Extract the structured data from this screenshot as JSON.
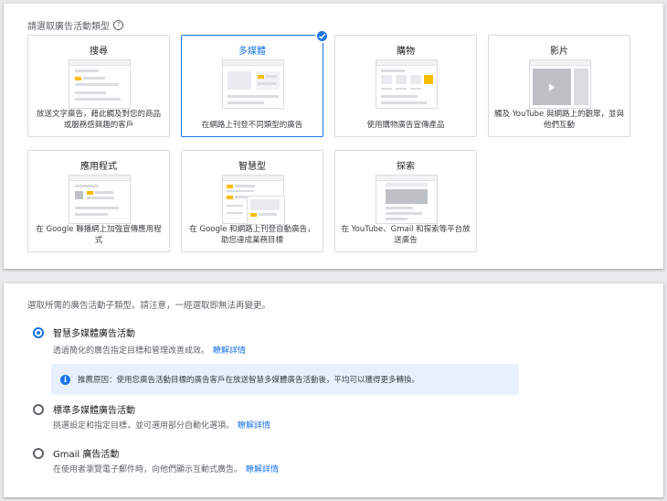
{
  "campaign_types": {
    "title": "請選取廣告活動類型",
    "help_icon": "question-circle-icon",
    "tiles": [
      {
        "label": "搜尋",
        "desc": "放送文字廣告，藉此觸及對您的商品或服務感興趣的客戶"
      },
      {
        "label": "多媒體",
        "desc": "在網路上刊登不同類型的廣告",
        "selected": true
      },
      {
        "label": "購物",
        "desc": "使用購物廣告宣傳產品"
      },
      {
        "label": "影片",
        "desc": "觸及 YouTube 與網路上的觀眾，並與他們互動"
      },
      {
        "label": "應用程式",
        "desc": "在 Google 聯播網上加強宣傳應用程式"
      },
      {
        "label": "智慧型",
        "desc": "在 Google 和網路上刊登自動廣告，助您達成業務目標"
      },
      {
        "label": "探索",
        "desc": "在 YouTube、Gmail 和探索等平台放送廣告"
      }
    ]
  },
  "subtypes": {
    "title": "選取所需的廣告活動子類型。請注意，一經選取即無法再變更。",
    "options": [
      {
        "label": "智慧多媒體廣告活動",
        "desc": "透過簡化的廣告指定目標和管理改善成效。",
        "link": "瞭解詳情",
        "checked": true
      },
      {
        "label": "標準多媒體廣告活動",
        "desc": "挑選設定和指定目標，並可選用部分自動化選項。",
        "link": "瞭解詳情",
        "checked": false
      },
      {
        "label": "Gmail 廣告活動",
        "desc": "在使用者瀏覽電子郵件時，向他們顯示互動式廣告。",
        "link": "瞭解詳情",
        "checked": false
      }
    ],
    "info": {
      "icon": "info-icon",
      "text": "推薦原因：使用您廣告活動目標的廣告客戶在放送智慧多媒體廣告活動後，平均可以獲得更多轉換。"
    }
  },
  "colors": {
    "accent": "#1a73e8",
    "yellow": "#fbbc04",
    "info_bg": "#e8f0fe"
  }
}
